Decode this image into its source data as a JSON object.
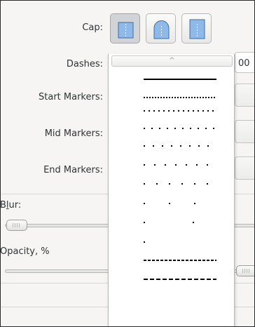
{
  "labels": {
    "cap": "Cap:",
    "dashes": "Dashes:",
    "start_markers": "Start Markers:",
    "mid_markers": "Mid Markers:",
    "end_markers": "End Markers:",
    "blur_pre": "B",
    "blur_mnemonic": "l",
    "blur_post": "ur:",
    "opacity": "Opacity, %"
  },
  "cap_buttons": [
    {
      "name": "butt",
      "icon": "butt-cap-icon",
      "active": true
    },
    {
      "name": "round",
      "icon": "round-cap-icon",
      "active": false
    },
    {
      "name": "square",
      "icon": "square-cap-icon",
      "active": false
    }
  ],
  "dash_entry_value": "00",
  "dash_dropdown": {
    "scroll_up": "^",
    "patterns": [
      {
        "style": "solid"
      },
      {
        "style": "dense-dots"
      },
      {
        "style": "dots"
      },
      {
        "style": "spaced-dots"
      },
      {
        "style": "wide-dots"
      },
      {
        "style": "wider-dots"
      },
      {
        "style": "sparse-dots"
      },
      {
        "style": "sparser-dots"
      },
      {
        "style": "single-dot"
      },
      {
        "style": "dashes"
      },
      {
        "style": "long-dashes"
      }
    ]
  },
  "colors": {
    "accent_cap": "#8fb9e8",
    "panel_bg": "#f6f5f4"
  }
}
